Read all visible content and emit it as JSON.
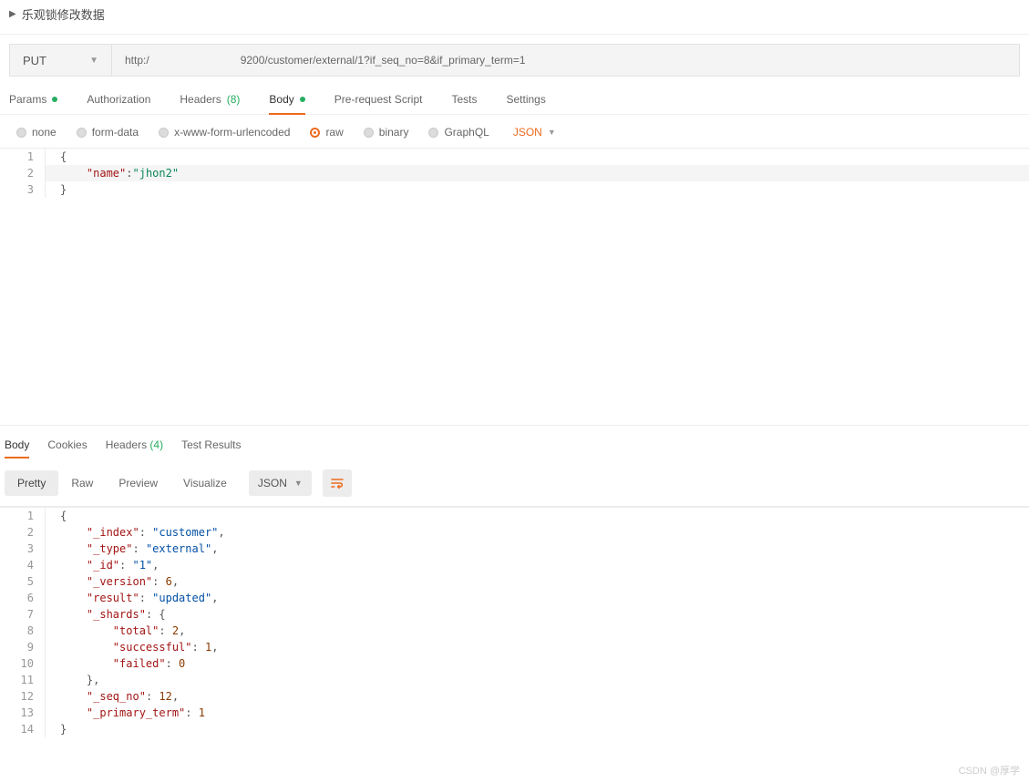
{
  "title": "乐观锁修改数据",
  "request": {
    "method": "PUT",
    "url_prefix": "http:/",
    "url_suffix": "9200/customer/external/1?if_seq_no=8&if_primary_term=1"
  },
  "tabs": {
    "params": "Params",
    "authorization": "Authorization",
    "headers": "Headers",
    "headers_count": "(8)",
    "body": "Body",
    "pre_request": "Pre-request Script",
    "tests": "Tests",
    "settings": "Settings"
  },
  "body_types": {
    "none": "none",
    "form_data": "form-data",
    "urlencoded": "x-www-form-urlencoded",
    "raw": "raw",
    "binary": "binary",
    "graphql": "GraphQL"
  },
  "body_lang": "JSON",
  "request_body": {
    "key": "\"name\"",
    "value": "\"jhon2\""
  },
  "response_tabs": {
    "body": "Body",
    "cookies": "Cookies",
    "headers": "Headers",
    "headers_count": "(4)",
    "test_results": "Test Results"
  },
  "view_modes": {
    "pretty": "Pretty",
    "raw": "Raw",
    "preview": "Preview",
    "visualize": "Visualize"
  },
  "response_format": "JSON",
  "response_data": {
    "_index": "customer",
    "_type": "external",
    "_id": "1",
    "_version": 6,
    "result": "updated",
    "_shards": {
      "total": 2,
      "successful": 1,
      "failed": 0
    },
    "_seq_no": 12,
    "_primary_term": 1
  },
  "response_lines": {
    "l2_k": "\"_index\"",
    "l2_v": "\"customer\"",
    "l3_k": "\"_type\"",
    "l3_v": "\"external\"",
    "l4_k": "\"_id\"",
    "l4_v": "\"1\"",
    "l5_k": "\"_version\"",
    "l5_v": "6",
    "l6_k": "\"result\"",
    "l6_v": "\"updated\"",
    "l7_k": "\"_shards\"",
    "l8_k": "\"total\"",
    "l8_v": "2",
    "l9_k": "\"successful\"",
    "l9_v": "1",
    "l10_k": "\"failed\"",
    "l10_v": "0",
    "l12_k": "\"_seq_no\"",
    "l12_v": "12",
    "l13_k": "\"_primary_term\"",
    "l13_v": "1"
  },
  "watermark": "CSDN @厚学"
}
